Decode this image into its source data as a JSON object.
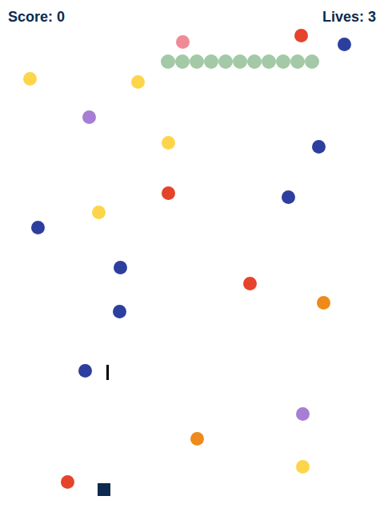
{
  "hud": {
    "score": "Score: 0",
    "lives": "Lives: 3"
  },
  "dots": [
    {
      "color": "#f08a96"
    },
    {
      "color": "#e5432a"
    },
    {
      "color": "#2d3f9e"
    },
    {
      "color": "#fdd54a"
    },
    {
      "color": "#fdd54a"
    },
    {
      "color": "#a67fd4"
    },
    {
      "color": "#fdd54a"
    },
    {
      "color": "#2d3f9e"
    },
    {
      "color": "#e5432a"
    },
    {
      "color": "#2d3f9e"
    },
    {
      "color": "#fdd54a"
    },
    {
      "color": "#2d3f9e"
    },
    {
      "color": "#2d3f9e"
    },
    {
      "color": "#e5432a"
    },
    {
      "color": "#ee8a1a"
    },
    {
      "color": "#2d3f9e"
    },
    {
      "color": "#2d3f9e"
    },
    {
      "color": "#a67fd4"
    },
    {
      "color": "#ee8a1a"
    },
    {
      "color": "#fdd54a"
    },
    {
      "color": "#e5432a"
    }
  ],
  "centipede": {
    "segments": [
      {
        "color": "#a3c9a7"
      },
      {
        "color": "#a3c9a7"
      },
      {
        "color": "#a3c9a7"
      },
      {
        "color": "#a3c9a7"
      },
      {
        "color": "#a3c9a7"
      },
      {
        "color": "#a3c9a7"
      },
      {
        "color": "#a3c9a7"
      },
      {
        "color": "#a3c9a7"
      },
      {
        "color": "#a3c9a7"
      },
      {
        "color": "#a3c9a7"
      },
      {
        "color": "#a3c9a7"
      }
    ]
  }
}
